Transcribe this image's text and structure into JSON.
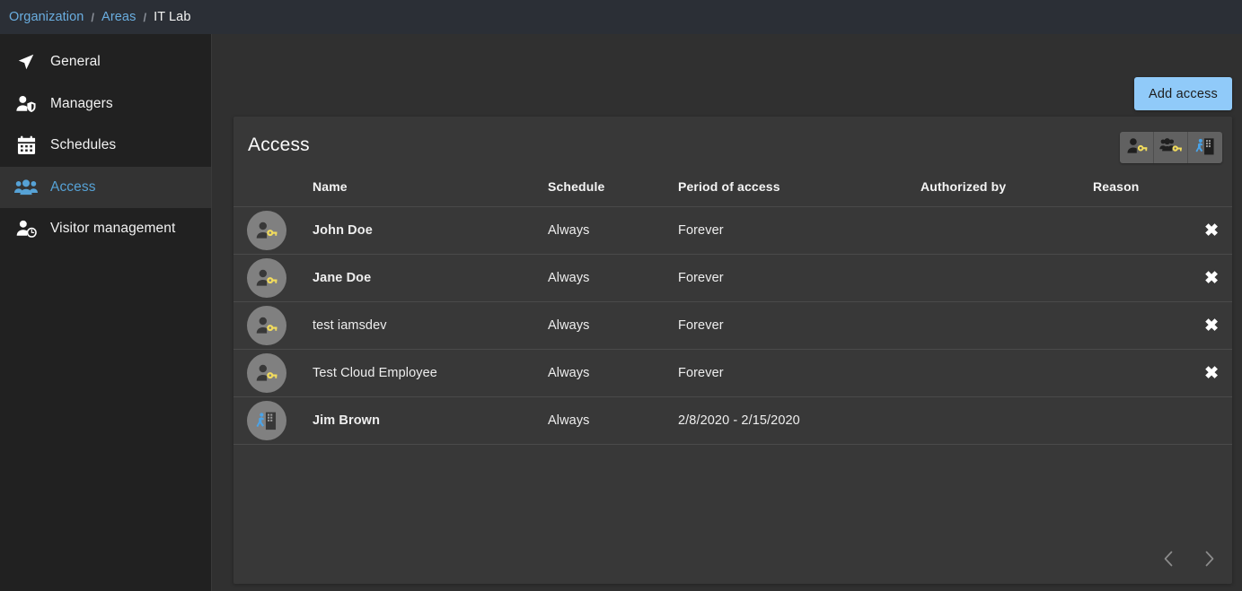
{
  "breadcrumb": {
    "separator": "/",
    "items": [
      {
        "label": "Organization",
        "current": false
      },
      {
        "label": "Areas",
        "current": false
      },
      {
        "label": "IT Lab",
        "current": true
      }
    ]
  },
  "sidebar": {
    "items": [
      {
        "label": "General",
        "icon": "navigation-arrow-icon",
        "active": false
      },
      {
        "label": "Managers",
        "icon": "person-shield-icon",
        "active": false
      },
      {
        "label": "Schedules",
        "icon": "calendar-icon",
        "active": false
      },
      {
        "label": "Access",
        "icon": "people-group-icon",
        "active": true
      },
      {
        "label": "Visitor management",
        "icon": "person-clock-icon",
        "active": false
      }
    ]
  },
  "toolbar": {
    "add_access_label": "Add access"
  },
  "card": {
    "title": "Access",
    "filters": [
      {
        "name": "person-key-filter",
        "icon": "person-key-icon",
        "selected": false
      },
      {
        "name": "group-key-filter",
        "icon": "group-key-icon",
        "selected": false
      },
      {
        "name": "visitor-filter",
        "icon": "visitor-door-icon",
        "selected": false
      }
    ],
    "table": {
      "headers": [
        "",
        "Name",
        "Schedule",
        "Period of access",
        "Authorized by",
        "Reason",
        ""
      ],
      "rows": [
        {
          "avatar": "person-key-avatar",
          "name": "John Doe",
          "bold": true,
          "schedule": "Always",
          "period": "Forever",
          "authorized_by": "",
          "reason": "",
          "removable": true
        },
        {
          "avatar": "person-key-avatar",
          "name": "Jane Doe",
          "bold": true,
          "schedule": "Always",
          "period": "Forever",
          "authorized_by": "",
          "reason": "",
          "removable": true
        },
        {
          "avatar": "person-key-avatar",
          "name": "test iamsdev",
          "bold": false,
          "schedule": "Always",
          "period": "Forever",
          "authorized_by": "",
          "reason": "",
          "removable": true
        },
        {
          "avatar": "person-key-avatar",
          "name": "Test Cloud Employee",
          "bold": false,
          "schedule": "Always",
          "period": "Forever",
          "authorized_by": "",
          "reason": "",
          "removable": true
        },
        {
          "avatar": "visitor-door-avatar",
          "name": "Jim Brown",
          "bold": true,
          "schedule": "Always",
          "period": "2/8/2020 - 2/15/2020",
          "authorized_by": "",
          "reason": "",
          "removable": false
        }
      ]
    },
    "pagination": {
      "prev_label": "‹",
      "next_label": "›"
    }
  },
  "colors": {
    "accent_blue": "#56a2d6",
    "button_blue": "#90caf9",
    "breadcrumb_link": "#6aaee0",
    "sidebar_bg": "#212121",
    "main_bg": "#303030",
    "card_bg": "#383838",
    "key_yellow": "#f2dc5d",
    "visitor_blue": "#4aa3e8"
  }
}
